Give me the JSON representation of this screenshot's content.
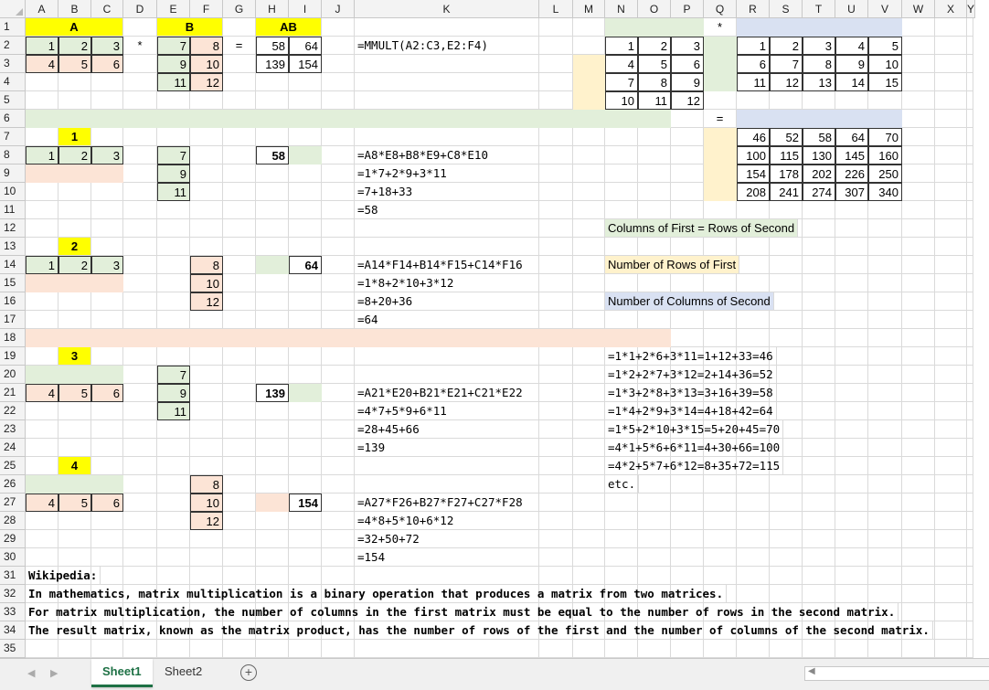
{
  "column_headers": [
    "A",
    "B",
    "C",
    "D",
    "E",
    "F",
    "G",
    "H",
    "I",
    "J",
    "K",
    "L",
    "M",
    "N",
    "O",
    "P",
    "Q",
    "R",
    "S",
    "T",
    "U",
    "V",
    "W",
    "X",
    "Y"
  ],
  "row_headers": [
    "1",
    "2",
    "3",
    "4",
    "5",
    "6",
    "7",
    "8",
    "9",
    "10",
    "11",
    "12",
    "13",
    "14",
    "15",
    "16",
    "17",
    "18",
    "19",
    "20",
    "21",
    "22",
    "23",
    "24",
    "25",
    "26",
    "27",
    "28",
    "29",
    "30",
    "31",
    "32",
    "33",
    "34",
    "35"
  ],
  "cells": [
    {
      "r": 1,
      "c": 1,
      "w": 3,
      "v": "A",
      "cls": "fillY bold ctr"
    },
    {
      "r": 1,
      "c": 5,
      "w": 2,
      "v": "B",
      "cls": "fillY bold ctr"
    },
    {
      "r": 1,
      "c": 8,
      "w": 2,
      "v": "AB",
      "cls": "fillY bold ctr"
    },
    {
      "r": 1,
      "c": 17,
      "v": "*",
      "cls": "ctr"
    },
    {
      "r": 2,
      "c": 1,
      "v": "1",
      "cls": "fillG num thin"
    },
    {
      "r": 2,
      "c": 2,
      "v": "2",
      "cls": "fillG num thin"
    },
    {
      "r": 2,
      "c": 3,
      "v": "3",
      "cls": "fillG num thin"
    },
    {
      "r": 2,
      "c": 4,
      "v": "*",
      "cls": "ctr"
    },
    {
      "r": 2,
      "c": 5,
      "v": "7",
      "cls": "fillG num thin"
    },
    {
      "r": 2,
      "c": 6,
      "v": "8",
      "cls": "fillP num thin"
    },
    {
      "r": 2,
      "c": 7,
      "v": "=",
      "cls": "ctr"
    },
    {
      "r": 2,
      "c": 8,
      "v": "58",
      "cls": "num thin"
    },
    {
      "r": 2,
      "c": 9,
      "v": "64",
      "cls": "num thin"
    },
    {
      "r": 2,
      "c": 11,
      "v": "=MMULT(A2:C3,E2:F4)",
      "cls": "mono"
    },
    {
      "r": 2,
      "c": 14,
      "v": "1",
      "cls": "num thin"
    },
    {
      "r": 2,
      "c": 15,
      "v": "2",
      "cls": "num thin"
    },
    {
      "r": 2,
      "c": 16,
      "v": "3",
      "cls": "num thin"
    },
    {
      "r": 2,
      "c": 18,
      "v": "1",
      "cls": "num thin"
    },
    {
      "r": 2,
      "c": 19,
      "v": "2",
      "cls": "num thin"
    },
    {
      "r": 2,
      "c": 20,
      "v": "3",
      "cls": "num thin"
    },
    {
      "r": 2,
      "c": 21,
      "v": "4",
      "cls": "num thin"
    },
    {
      "r": 2,
      "c": 22,
      "v": "5",
      "cls": "num thin"
    },
    {
      "r": 3,
      "c": 1,
      "v": "4",
      "cls": "fillP num thin"
    },
    {
      "r": 3,
      "c": 2,
      "v": "5",
      "cls": "fillP num thin"
    },
    {
      "r": 3,
      "c": 3,
      "v": "6",
      "cls": "fillP num thin"
    },
    {
      "r": 3,
      "c": 5,
      "v": "9",
      "cls": "fillG num thin"
    },
    {
      "r": 3,
      "c": 6,
      "v": "10",
      "cls": "fillP num thin"
    },
    {
      "r": 3,
      "c": 8,
      "v": "139",
      "cls": "num thin"
    },
    {
      "r": 3,
      "c": 9,
      "v": "154",
      "cls": "num thin"
    },
    {
      "r": 3,
      "c": 14,
      "v": "4",
      "cls": "num thin"
    },
    {
      "r": 3,
      "c": 15,
      "v": "5",
      "cls": "num thin"
    },
    {
      "r": 3,
      "c": 16,
      "v": "6",
      "cls": "num thin"
    },
    {
      "r": 3,
      "c": 18,
      "v": "6",
      "cls": "num thin"
    },
    {
      "r": 3,
      "c": 19,
      "v": "7",
      "cls": "num thin"
    },
    {
      "r": 3,
      "c": 20,
      "v": "8",
      "cls": "num thin"
    },
    {
      "r": 3,
      "c": 21,
      "v": "9",
      "cls": "num thin"
    },
    {
      "r": 3,
      "c": 22,
      "v": "10",
      "cls": "num thin"
    },
    {
      "r": 4,
      "c": 5,
      "v": "11",
      "cls": "fillG num thin"
    },
    {
      "r": 4,
      "c": 6,
      "v": "12",
      "cls": "fillP num thin"
    },
    {
      "r": 4,
      "c": 14,
      "v": "7",
      "cls": "num thin"
    },
    {
      "r": 4,
      "c": 15,
      "v": "8",
      "cls": "num thin"
    },
    {
      "r": 4,
      "c": 16,
      "v": "9",
      "cls": "num thin"
    },
    {
      "r": 4,
      "c": 18,
      "v": "11",
      "cls": "num thin"
    },
    {
      "r": 4,
      "c": 19,
      "v": "12",
      "cls": "num thin"
    },
    {
      "r": 4,
      "c": 20,
      "v": "13",
      "cls": "num thin"
    },
    {
      "r": 4,
      "c": 21,
      "v": "14",
      "cls": "num thin"
    },
    {
      "r": 4,
      "c": 22,
      "v": "15",
      "cls": "num thin"
    },
    {
      "r": 5,
      "c": 14,
      "v": "10",
      "cls": "num thin"
    },
    {
      "r": 5,
      "c": 15,
      "v": "11",
      "cls": "num thin"
    },
    {
      "r": 5,
      "c": 16,
      "v": "12",
      "cls": "num thin"
    },
    {
      "r": 6,
      "c": 17,
      "v": "=",
      "cls": "ctr"
    },
    {
      "r": 7,
      "c": 2,
      "v": "1",
      "cls": "fillY bold ctr"
    },
    {
      "r": 7,
      "c": 18,
      "v": "46",
      "cls": "num thin"
    },
    {
      "r": 7,
      "c": 19,
      "v": "52",
      "cls": "num thin"
    },
    {
      "r": 7,
      "c": 20,
      "v": "58",
      "cls": "num thin"
    },
    {
      "r": 7,
      "c": 21,
      "v": "64",
      "cls": "num thin"
    },
    {
      "r": 7,
      "c": 22,
      "v": "70",
      "cls": "num thin"
    },
    {
      "r": 8,
      "c": 1,
      "v": "1",
      "cls": "fillG num thin"
    },
    {
      "r": 8,
      "c": 2,
      "v": "2",
      "cls": "fillG num thin"
    },
    {
      "r": 8,
      "c": 3,
      "v": "3",
      "cls": "fillG num thin"
    },
    {
      "r": 8,
      "c": 5,
      "v": "7",
      "cls": "fillG num thin"
    },
    {
      "r": 8,
      "c": 8,
      "v": "58",
      "cls": "bold num thin"
    },
    {
      "r": 8,
      "c": 11,
      "v": "=A8*E8+B8*E9+C8*E10",
      "cls": "mono"
    },
    {
      "r": 8,
      "c": 18,
      "v": "100",
      "cls": "num thin"
    },
    {
      "r": 8,
      "c": 19,
      "v": "115",
      "cls": "num thin"
    },
    {
      "r": 8,
      "c": 20,
      "v": "130",
      "cls": "num thin"
    },
    {
      "r": 8,
      "c": 21,
      "v": "145",
      "cls": "num thin"
    },
    {
      "r": 8,
      "c": 22,
      "v": "160",
      "cls": "num thin"
    },
    {
      "r": 9,
      "c": 5,
      "v": "9",
      "cls": "fillG num thin"
    },
    {
      "r": 9,
      "c": 11,
      "v": "=1*7+2*9+3*11",
      "cls": "mono"
    },
    {
      "r": 9,
      "c": 18,
      "v": "154",
      "cls": "num thin"
    },
    {
      "r": 9,
      "c": 19,
      "v": "178",
      "cls": "num thin"
    },
    {
      "r": 9,
      "c": 20,
      "v": "202",
      "cls": "num thin"
    },
    {
      "r": 9,
      "c": 21,
      "v": "226",
      "cls": "num thin"
    },
    {
      "r": 9,
      "c": 22,
      "v": "250",
      "cls": "num thin"
    },
    {
      "r": 10,
      "c": 5,
      "v": "11",
      "cls": "fillG num thin"
    },
    {
      "r": 10,
      "c": 11,
      "v": "=7+18+33",
      "cls": "mono"
    },
    {
      "r": 10,
      "c": 18,
      "v": "208",
      "cls": "num thin"
    },
    {
      "r": 10,
      "c": 19,
      "v": "241",
      "cls": "num thin"
    },
    {
      "r": 10,
      "c": 20,
      "v": "274",
      "cls": "num thin"
    },
    {
      "r": 10,
      "c": 21,
      "v": "307",
      "cls": "num thin"
    },
    {
      "r": 10,
      "c": 22,
      "v": "340",
      "cls": "num thin"
    },
    {
      "r": 11,
      "c": 11,
      "v": "=58",
      "cls": "mono"
    },
    {
      "r": 12,
      "c": 14,
      "w": 3,
      "v": "Columns of First = Rows of Second",
      "cls": "fillG"
    },
    {
      "r": 13,
      "c": 2,
      "v": "2",
      "cls": "fillY bold ctr"
    },
    {
      "r": 14,
      "c": 1,
      "v": "1",
      "cls": "fillG num thin"
    },
    {
      "r": 14,
      "c": 2,
      "v": "2",
      "cls": "fillG num thin"
    },
    {
      "r": 14,
      "c": 3,
      "v": "3",
      "cls": "fillG num thin"
    },
    {
      "r": 14,
      "c": 6,
      "v": "8",
      "cls": "fillP num thin"
    },
    {
      "r": 14,
      "c": 9,
      "v": "64",
      "cls": "bold num thin"
    },
    {
      "r": 14,
      "c": 11,
      "v": "=A14*F14+B14*F15+C14*F16",
      "cls": "mono"
    },
    {
      "r": 14,
      "c": 14,
      "w": 3,
      "v": "Number of Rows of First",
      "cls": "fillT"
    },
    {
      "r": 15,
      "c": 6,
      "v": "10",
      "cls": "fillP num thin"
    },
    {
      "r": 15,
      "c": 11,
      "v": "=1*8+2*10+3*12",
      "cls": "mono"
    },
    {
      "r": 16,
      "c": 6,
      "v": "12",
      "cls": "fillP num thin"
    },
    {
      "r": 16,
      "c": 11,
      "v": "=8+20+36",
      "cls": "mono"
    },
    {
      "r": 16,
      "c": 14,
      "w": 3,
      "v": "Number of Columns of Second",
      "cls": "fillB"
    },
    {
      "r": 17,
      "c": 11,
      "v": "=64",
      "cls": "mono"
    },
    {
      "r": 19,
      "c": 2,
      "v": "3",
      "cls": "fillY bold ctr"
    },
    {
      "r": 19,
      "c": 14,
      "v": "=1*1+2*6+3*11=1+12+33=46",
      "cls": "mono"
    },
    {
      "r": 20,
      "c": 5,
      "v": "7",
      "cls": "fillG num thin"
    },
    {
      "r": 20,
      "c": 14,
      "v": "=1*2+2*7+3*12=2+14+36=52",
      "cls": "mono"
    },
    {
      "r": 21,
      "c": 1,
      "v": "4",
      "cls": "fillP num thin"
    },
    {
      "r": 21,
      "c": 2,
      "v": "5",
      "cls": "fillP num thin"
    },
    {
      "r": 21,
      "c": 3,
      "v": "6",
      "cls": "fillP num thin"
    },
    {
      "r": 21,
      "c": 5,
      "v": "9",
      "cls": "fillG num thin"
    },
    {
      "r": 21,
      "c": 8,
      "v": "139",
      "cls": "bold num thin"
    },
    {
      "r": 21,
      "c": 11,
      "v": "=A21*E20+B21*E21+C21*E22",
      "cls": "mono"
    },
    {
      "r": 21,
      "c": 14,
      "v": "=1*3+2*8+3*13=3+16+39=58",
      "cls": "mono"
    },
    {
      "r": 22,
      "c": 5,
      "v": "11",
      "cls": "fillG num thin"
    },
    {
      "r": 22,
      "c": 11,
      "v": "=4*7+5*9+6*11",
      "cls": "mono"
    },
    {
      "r": 22,
      "c": 14,
      "v": "=1*4+2*9+3*14=4+18+42=64",
      "cls": "mono"
    },
    {
      "r": 23,
      "c": 11,
      "v": "=28+45+66",
      "cls": "mono"
    },
    {
      "r": 23,
      "c": 14,
      "v": "=1*5+2*10+3*15=5+20+45=70",
      "cls": "mono"
    },
    {
      "r": 24,
      "c": 11,
      "v": "=139",
      "cls": "mono"
    },
    {
      "r": 24,
      "c": 14,
      "v": "=4*1+5*6+6*11=4+30+66=100",
      "cls": "mono"
    },
    {
      "r": 25,
      "c": 2,
      "v": "4",
      "cls": "fillY bold ctr"
    },
    {
      "r": 25,
      "c": 14,
      "v": "=4*2+5*7+6*12=8+35+72=115",
      "cls": "mono"
    },
    {
      "r": 26,
      "c": 6,
      "v": "8",
      "cls": "fillP num thin"
    },
    {
      "r": 26,
      "c": 14,
      "v": "etc.",
      "cls": "mono"
    },
    {
      "r": 27,
      "c": 1,
      "v": "4",
      "cls": "fillP num thin"
    },
    {
      "r": 27,
      "c": 2,
      "v": "5",
      "cls": "fillP num thin"
    },
    {
      "r": 27,
      "c": 3,
      "v": "6",
      "cls": "fillP num thin"
    },
    {
      "r": 27,
      "c": 6,
      "v": "10",
      "cls": "fillP num thin"
    },
    {
      "r": 27,
      "c": 9,
      "v": "154",
      "cls": "bold num thin"
    },
    {
      "r": 27,
      "c": 11,
      "v": "=A27*F26+B27*F27+C27*F28",
      "cls": "mono"
    },
    {
      "r": 28,
      "c": 6,
      "v": "12",
      "cls": "fillP num thin"
    },
    {
      "r": 28,
      "c": 11,
      "v": "=4*8+5*10+6*12",
      "cls": "mono"
    },
    {
      "r": 29,
      "c": 11,
      "v": "=32+50+72",
      "cls": "mono"
    },
    {
      "r": 30,
      "c": 11,
      "v": "=154",
      "cls": "mono"
    },
    {
      "r": 31,
      "c": 1,
      "v": "Wikipedia:",
      "cls": "monob"
    },
    {
      "r": 32,
      "c": 1,
      "v": "In mathematics, matrix multiplication is a binary operation that produces a matrix from two matrices.",
      "cls": "monob"
    },
    {
      "r": 33,
      "c": 1,
      "v": "For matrix multiplication, the number of columns in the first matrix must be equal to the number of rows in the second matrix.",
      "cls": "monob"
    },
    {
      "r": 34,
      "c": 1,
      "v": "The result matrix, known as the matrix product, has the number of rows of the first and the number of columns of the second matrix.",
      "cls": "monob"
    }
  ],
  "fills": [
    {
      "r": 2,
      "c": 17,
      "rows": 3,
      "cols": 1,
      "color": "#e2efda"
    },
    {
      "r": 3,
      "c": 13,
      "rows": 3,
      "cols": 1,
      "color": "#fff2cc"
    },
    {
      "r": 1,
      "c": 14,
      "rows": 1,
      "cols": 3,
      "color": "#e2efda"
    },
    {
      "r": 1,
      "c": 18,
      "rows": 1,
      "cols": 5,
      "color": "#d9e1f2"
    },
    {
      "r": 6,
      "c": 1,
      "rows": 1,
      "cols": 15,
      "color": "#e2efda"
    },
    {
      "r": 6,
      "c": 18,
      "rows": 1,
      "cols": 5,
      "color": "#d9e1f2"
    },
    {
      "r": 7,
      "c": 17,
      "rows": 4,
      "cols": 1,
      "color": "#fff2cc"
    },
    {
      "r": 8,
      "c": 9,
      "rows": 1,
      "cols": 1,
      "color": "#e2efda"
    },
    {
      "r": 9,
      "c": 1,
      "rows": 1,
      "cols": 3,
      "color": "#fce4d6"
    },
    {
      "r": 14,
      "c": 8,
      "rows": 1,
      "cols": 1,
      "color": "#e2efda"
    },
    {
      "r": 15,
      "c": 1,
      "rows": 1,
      "cols": 3,
      "color": "#fce4d6"
    },
    {
      "r": 18,
      "c": 1,
      "rows": 1,
      "cols": 15,
      "color": "#fce4d6"
    },
    {
      "r": 20,
      "c": 1,
      "rows": 1,
      "cols": 3,
      "color": "#e2efda"
    },
    {
      "r": 21,
      "c": 9,
      "rows": 1,
      "cols": 1,
      "color": "#e2efda"
    },
    {
      "r": 26,
      "c": 1,
      "rows": 1,
      "cols": 3,
      "color": "#e2efda"
    },
    {
      "r": 27,
      "c": 8,
      "rows": 1,
      "cols": 1,
      "color": "#fce4d6"
    }
  ],
  "sheet_tabs": [
    "Sheet1",
    "Sheet2"
  ],
  "active_sheet": "Sheet1",
  "add_sheet_glyph": "+",
  "colors": {
    "yellow": "#ffff00",
    "green_fill": "#e2efda",
    "pink_fill": "#fce4d6",
    "tan_fill": "#fff2cc",
    "blue_fill": "#d9e1f2",
    "active_tab_text": "#1e7145"
  }
}
